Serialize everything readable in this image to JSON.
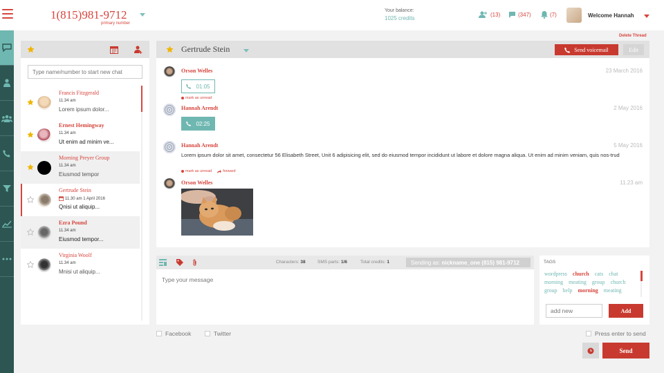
{
  "header": {
    "phone_number": "1(815)981-9712",
    "phone_sub": "primary number",
    "balance_label": "Your balance:",
    "balance_value": "1025 credits",
    "contacts_count": "(13)",
    "messages_count": "(347)",
    "notifications_count": "(7)",
    "welcome": "Welcome Hannah"
  },
  "contacts": {
    "search_placeholder": "Type name/number to start new chat",
    "items": [
      {
        "name": "Francis Fitzgerald",
        "time": "11.34 am",
        "preview": "Lorem ipsum dolor..."
      },
      {
        "name": "Ernest Hemingway",
        "time": "11.34 am",
        "preview": "Ut enim ad minim ve..."
      },
      {
        "name": "Morning Preyer Group",
        "time": "11.34 am",
        "preview": "Eiusmod tempor"
      },
      {
        "name": "Gertrude Stein",
        "time": "11.30 am 1 April 2016",
        "preview": "Qnisi ut aliquip..."
      },
      {
        "name": "Ezra Pound",
        "time": "11.34 am",
        "preview": "Eiusmod tempor..."
      },
      {
        "name": "Virginia Woolf",
        "time": "11.34 am",
        "preview": "Mnisi ut aliquip..."
      }
    ]
  },
  "thread": {
    "delete_label": "Delete Thread",
    "contact_name": "Gertrude Stein",
    "voicemail_label": "Send voicemail",
    "edit_label": "Edit",
    "messages": [
      {
        "author": "Orson Welles",
        "date": "23 March 2016",
        "call_duration": "01:05",
        "mark_unread": "mark as unread"
      },
      {
        "author": "Hannah Arendt",
        "date": "2 May 2016",
        "call_duration": "02:25"
      },
      {
        "author": "Hannah Arendt",
        "date": "5 May 2016",
        "text": "Lorem ipsum dolor sit amet, consectetur 56 Elisabeth Street, Unit 6 adipisicing elit, sed do eiusmod tempor incididunt ut labore et dolore magna aliqua. Ut enim ad minim veniam, quis nos-trud",
        "mark_unread": "mark as unread",
        "forward": "forward"
      },
      {
        "author": "Orson Welles",
        "date": "11.23 am"
      }
    ]
  },
  "composer": {
    "characters_label": "Characters:",
    "characters_value": "38",
    "sms_parts_label": "SMS parts:",
    "sms_parts_value": "1/6",
    "total_credits_label": "Total credits:",
    "total_credits_value": "1",
    "sending_as_label": "Sending as:",
    "sending_as_value": "nickname_one (815) 981-9712",
    "placeholder": "Type your message",
    "facebook_label": "Facebook",
    "twitter_label": "Twitter",
    "press_enter_label": "Press enter to send",
    "send_label": "Send"
  },
  "tags": {
    "title": "TAGS",
    "items": [
      {
        "label": "wordpress",
        "hot": false
      },
      {
        "label": "church",
        "hot": true
      },
      {
        "label": "cats",
        "hot": false
      },
      {
        "label": "chat",
        "hot": false
      },
      {
        "label": "morning",
        "hot": false
      },
      {
        "label": "meating",
        "hot": false
      },
      {
        "label": "group",
        "hot": false
      },
      {
        "label": "church",
        "hot": false
      },
      {
        "label": "group",
        "hot": false
      },
      {
        "label": "help",
        "hot": false
      },
      {
        "label": "morning",
        "hot": true
      },
      {
        "label": "meating",
        "hot": false
      }
    ],
    "add_placeholder": "add new",
    "add_label": "Add"
  },
  "colors": {
    "accent": "#d6453d",
    "teal": "#6fb7b1",
    "rail": "#2d5551"
  }
}
